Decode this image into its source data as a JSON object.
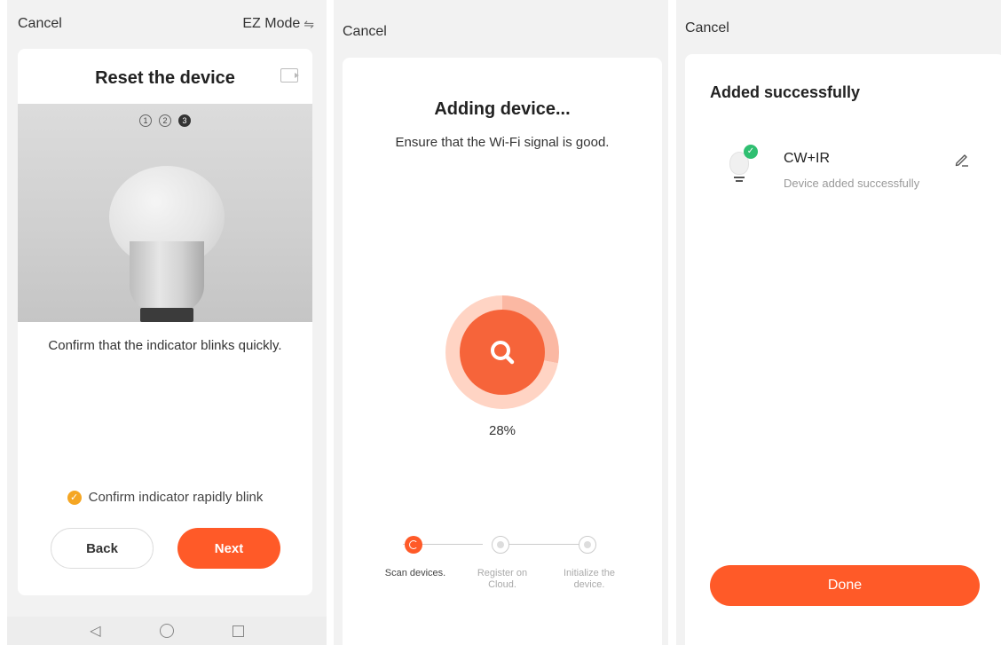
{
  "screen1": {
    "cancel_label": "Cancel",
    "mode_label": "EZ Mode",
    "mode_icon": "⇋",
    "title": "Reset the device",
    "steps": [
      "1",
      "2",
      "3"
    ],
    "active_step": 3,
    "instruction": "Confirm that the indicator blinks quickly.",
    "confirm_label": "Confirm indicator rapidly blink",
    "back_label": "Back",
    "next_label": "Next"
  },
  "screen2": {
    "cancel_label": "Cancel",
    "title": "Adding device...",
    "subtitle": "Ensure that the Wi-Fi signal is good.",
    "progress_percent": "28%",
    "progress_value": 28,
    "steps": [
      {
        "label": "Scan devices.",
        "state": "active"
      },
      {
        "label": "Register on Cloud.",
        "state": "pending"
      },
      {
        "label": "Initialize the device.",
        "state": "pending"
      }
    ]
  },
  "screen3": {
    "cancel_label": "Cancel",
    "title": "Added successfully",
    "device_name": "CW+IR",
    "device_status": "Device added successfully",
    "done_label": "Done"
  },
  "colors": {
    "accent": "#ff5a28",
    "confirm_check": "#f5a623",
    "success_check": "#2fbf71"
  }
}
